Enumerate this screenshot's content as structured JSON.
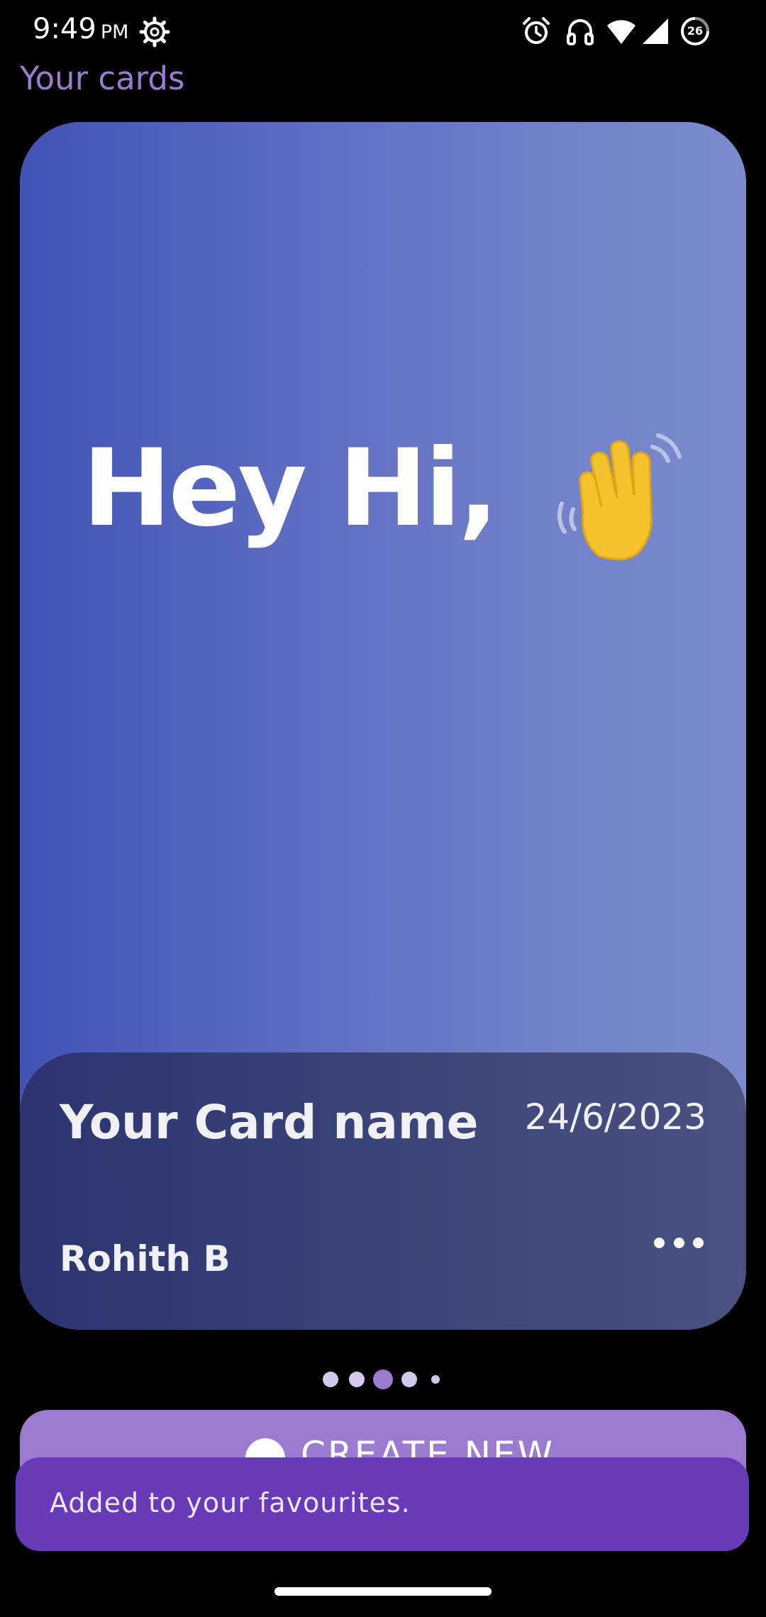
{
  "status_bar": {
    "time": "9:49",
    "ampm": "PM",
    "icons": [
      "settings-gear-icon",
      "alarm-icon",
      "headphones-icon",
      "wifi-icon",
      "cell-signal-icon",
      "battery-saver-icon"
    ],
    "battery_badge": "26"
  },
  "header": {
    "title": "Your cards"
  },
  "card": {
    "greeting": "Hey Hi,",
    "greeting_icon": "waving-hand-icon",
    "name": "Your Card name",
    "date": "24/6/2023",
    "owner": "Rohith B",
    "more_icon": "more-horizontal-icon",
    "gradient_colors": [
      "#4153b5",
      "#7b8bcd"
    ],
    "info_colors": [
      "#2c3470",
      "#4a5282"
    ]
  },
  "pager": {
    "count": 5,
    "active_index": 2,
    "active_color": "#9b7bd0",
    "inactive_color": "#d5c8ef"
  },
  "create_button": {
    "label": "CREATE NEW",
    "icon": "add-circle-icon",
    "color": "#9b7bd0"
  },
  "snackbar": {
    "message": "Added to your favourites.",
    "color": "#673ab7"
  },
  "colors": {
    "background": "#000000",
    "accent": "#9b7bd0"
  }
}
